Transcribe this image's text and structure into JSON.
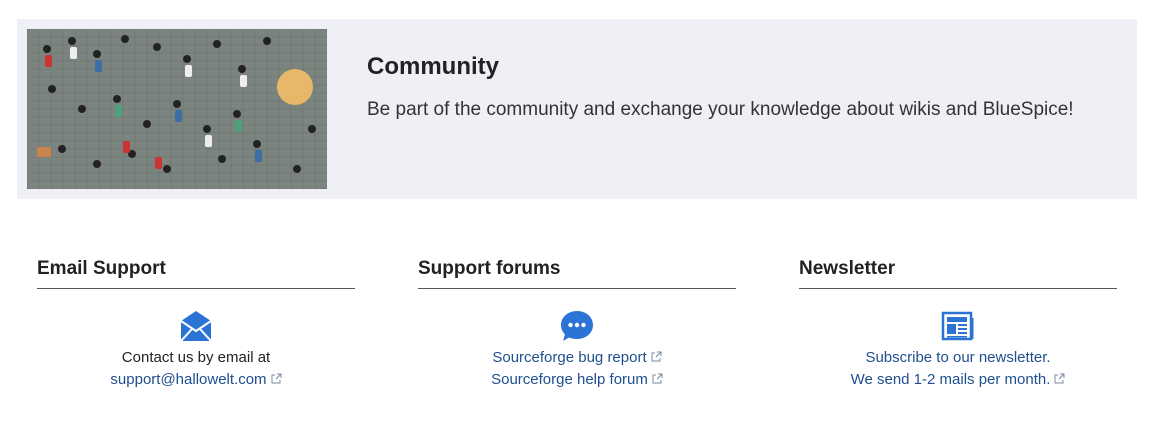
{
  "banner": {
    "title": "Community",
    "text": "Be part of the community and exchange your knowledge about wikis and BlueSpice!",
    "image_alt": "crowd-photo"
  },
  "columns": [
    {
      "heading": "Email Support",
      "icon": "envelope-icon",
      "line1": "Contact us by email at",
      "link": "support@hallowelt.com"
    },
    {
      "heading": "Support forums",
      "icon": "chat-bubble-icon",
      "link1": "Sourceforge bug report",
      "link2": "Sourceforge help forum"
    },
    {
      "heading": "Newsletter",
      "icon": "newspaper-icon",
      "link1": "Subscribe to our newsletter.",
      "link2": "We send 1-2 mails per month."
    }
  ],
  "colors": {
    "accent": "#2b74d6",
    "link": "#1f4f8e",
    "banner_bg": "#eff0f6"
  }
}
